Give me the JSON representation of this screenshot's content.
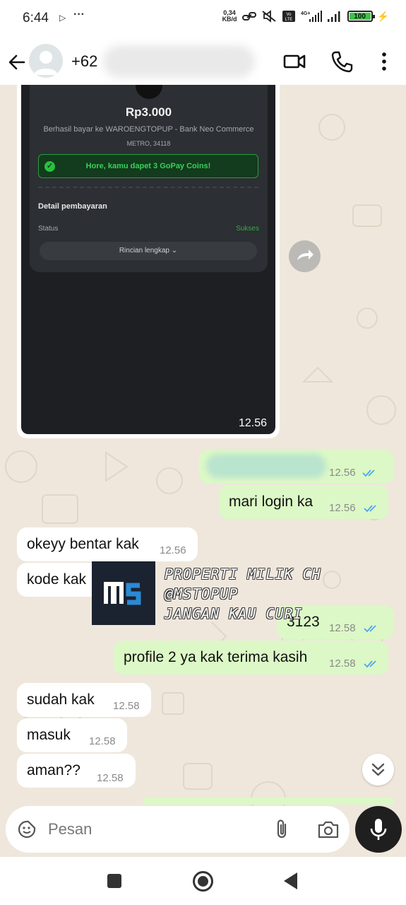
{
  "status_bar": {
    "time": "6:44",
    "net_speed_value": "0,34",
    "net_speed_unit": "KB/d",
    "battery": "100"
  },
  "header": {
    "contact_name": "+62"
  },
  "image_message": {
    "receipt": {
      "amount": "Rp3.000",
      "description": "Berhasil bayar ke WAROENGTOPUP - Bank Neo Commerce",
      "address": "METRO, 34118",
      "banner": "Hore, kamu dapet 3 GoPay Coins!",
      "detail_label": "Detail pembayaran",
      "status_label": "Status",
      "status_value": "Sukses",
      "details_button": "Rincian lengkap"
    },
    "time": "12.56"
  },
  "messages": [
    {
      "dir": "out",
      "text": "",
      "time": "12.56",
      "redacted": true
    },
    {
      "dir": "out",
      "text": "mari login ka",
      "time": "12.56"
    },
    {
      "dir": "in",
      "text": "okeyy bentar kak",
      "time": "12.56"
    },
    {
      "dir": "in",
      "text": "kode kak",
      "time": ""
    },
    {
      "dir": "out",
      "text": "3123",
      "time": "12.58"
    },
    {
      "dir": "out",
      "text": "profile 2 ya kak terima kasih",
      "time": "12.58"
    },
    {
      "dir": "in",
      "text": "sudah kak",
      "time": "12.58"
    },
    {
      "dir": "in",
      "text": "masuk",
      "time": "12.58"
    },
    {
      "dir": "in",
      "text": "aman??",
      "time": "12.58"
    }
  ],
  "watermark": {
    "line1": "PROPERTI MILIK CH",
    "line2": "@MSTOPUP",
    "line3": "JANGAN KAU CURI"
  },
  "input": {
    "placeholder": "Pesan"
  },
  "colors": {
    "chat_bg": "#efe7dc",
    "bubble_out": "#dcf8c6",
    "bubble_in": "#ffffff",
    "ticks": "#4fa6f0"
  }
}
